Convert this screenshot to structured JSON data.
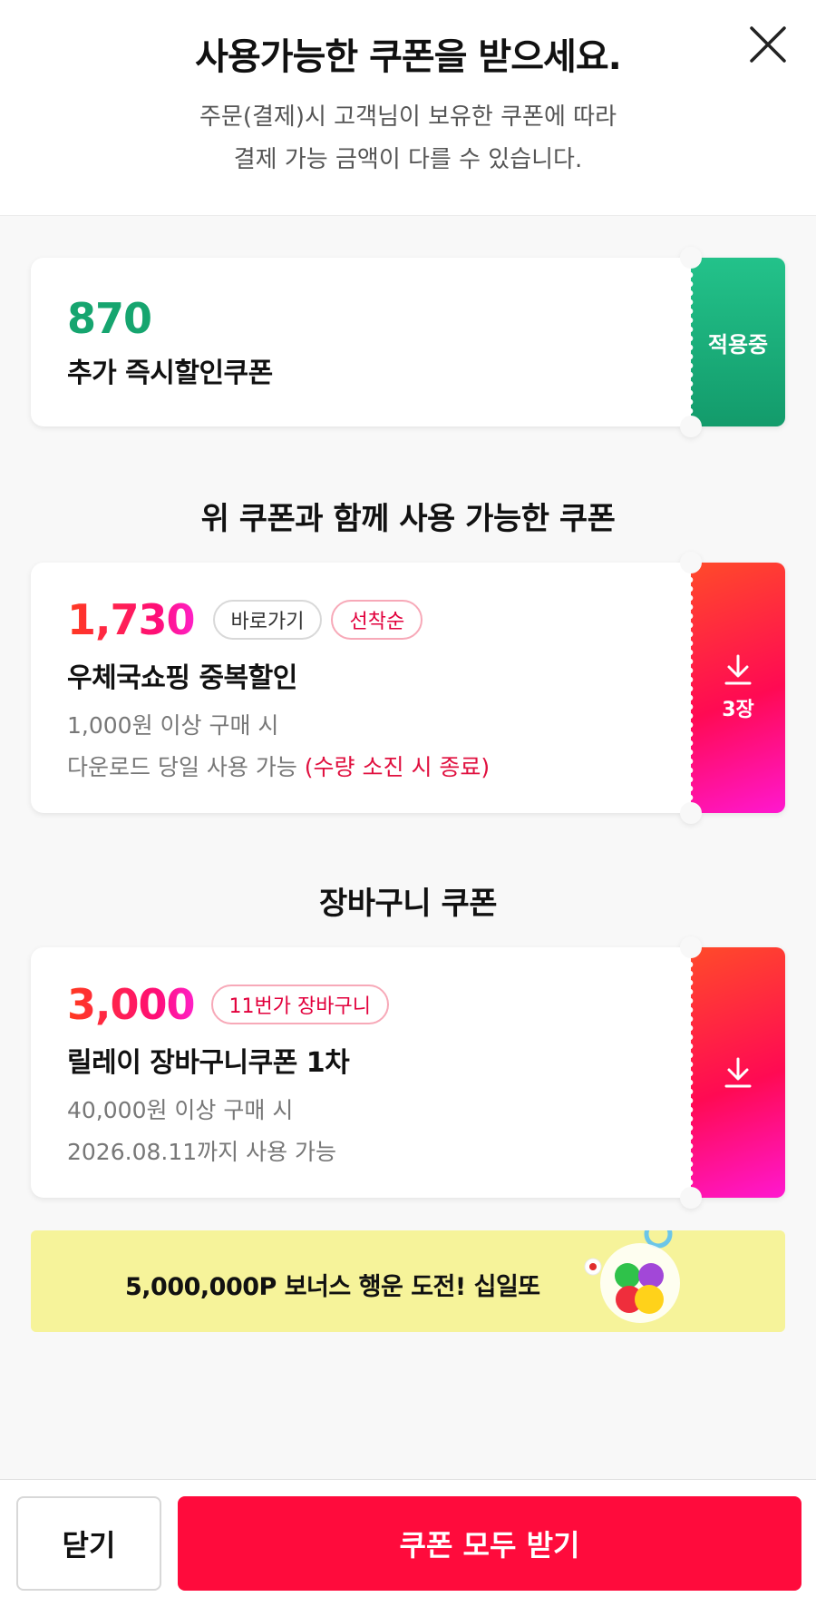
{
  "header": {
    "title": "사용가능한 쿠폰을 받으세요.",
    "subtitle_line1": "주문(결제)시 고객님이 보유한 쿠폰에 따라",
    "subtitle_line2": "결제 가능 금액이 다를 수 있습니다.",
    "close_icon": "close-icon"
  },
  "applied_coupon": {
    "amount": "870",
    "name": "추가 즉시할인쿠폰",
    "tab_label": "적용중",
    "color": "#16a56f"
  },
  "section_combo": {
    "title": "위 쿠폰과 함께 사용 가능한 쿠폰"
  },
  "combo_coupon": {
    "amount": "1,730",
    "badge_goto": "바로가기",
    "badge_first": "선착순",
    "name": "우체국쇼핑 중복할인",
    "condition": "1,000원 이상 구매 시",
    "validity": "다운로드 당일 사용 가능",
    "validity_note": "(수량 소진 시 종료)",
    "tab_label": "3장",
    "tab_icon": "download-icon"
  },
  "section_cart": {
    "title": "장바구니 쿠폰"
  },
  "cart_coupon": {
    "amount": "3,000",
    "badge": "11번가 장바구니",
    "name": "릴레이 장바구니쿠폰 1차",
    "condition": "40,000원 이상 구매 시",
    "validity": "2026.08.11까지 사용 가능",
    "tab_icon": "download-icon"
  },
  "banner": {
    "text": "5,000,000P 보너스 행운 도전! 십일또",
    "background": "#f6f39a",
    "icon": "lottery-balls-icon"
  },
  "footer": {
    "close_label": "닫기",
    "download_all_label": "쿠폰 모두 받기",
    "accent": "#ff0b3c"
  }
}
